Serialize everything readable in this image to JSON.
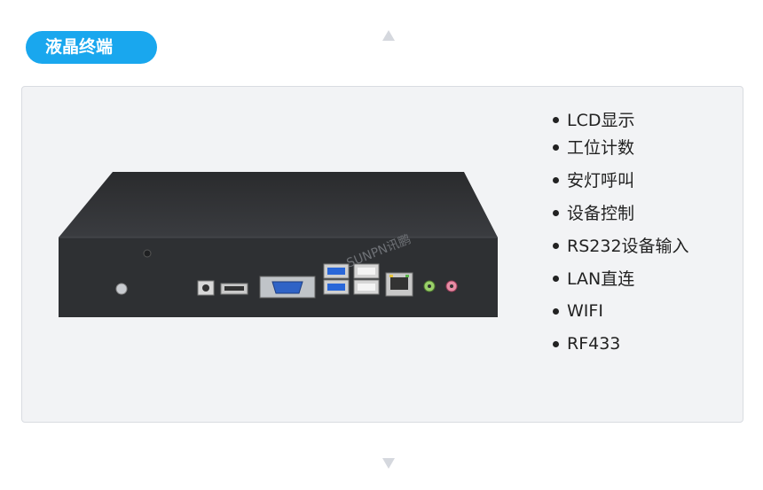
{
  "header": {
    "title": "液晶终端"
  },
  "features": [
    "LCD显示",
    "工位计数",
    "安灯呼叫",
    "设备控制",
    "RS232设备输入",
    "LAN直连",
    "WIFI",
    "RF433"
  ],
  "product": {
    "watermark": "SUNPN讯鹏"
  },
  "colors": {
    "accent": "#19a7ee",
    "panel": "#f2f3f5",
    "device": "#2e3033"
  }
}
